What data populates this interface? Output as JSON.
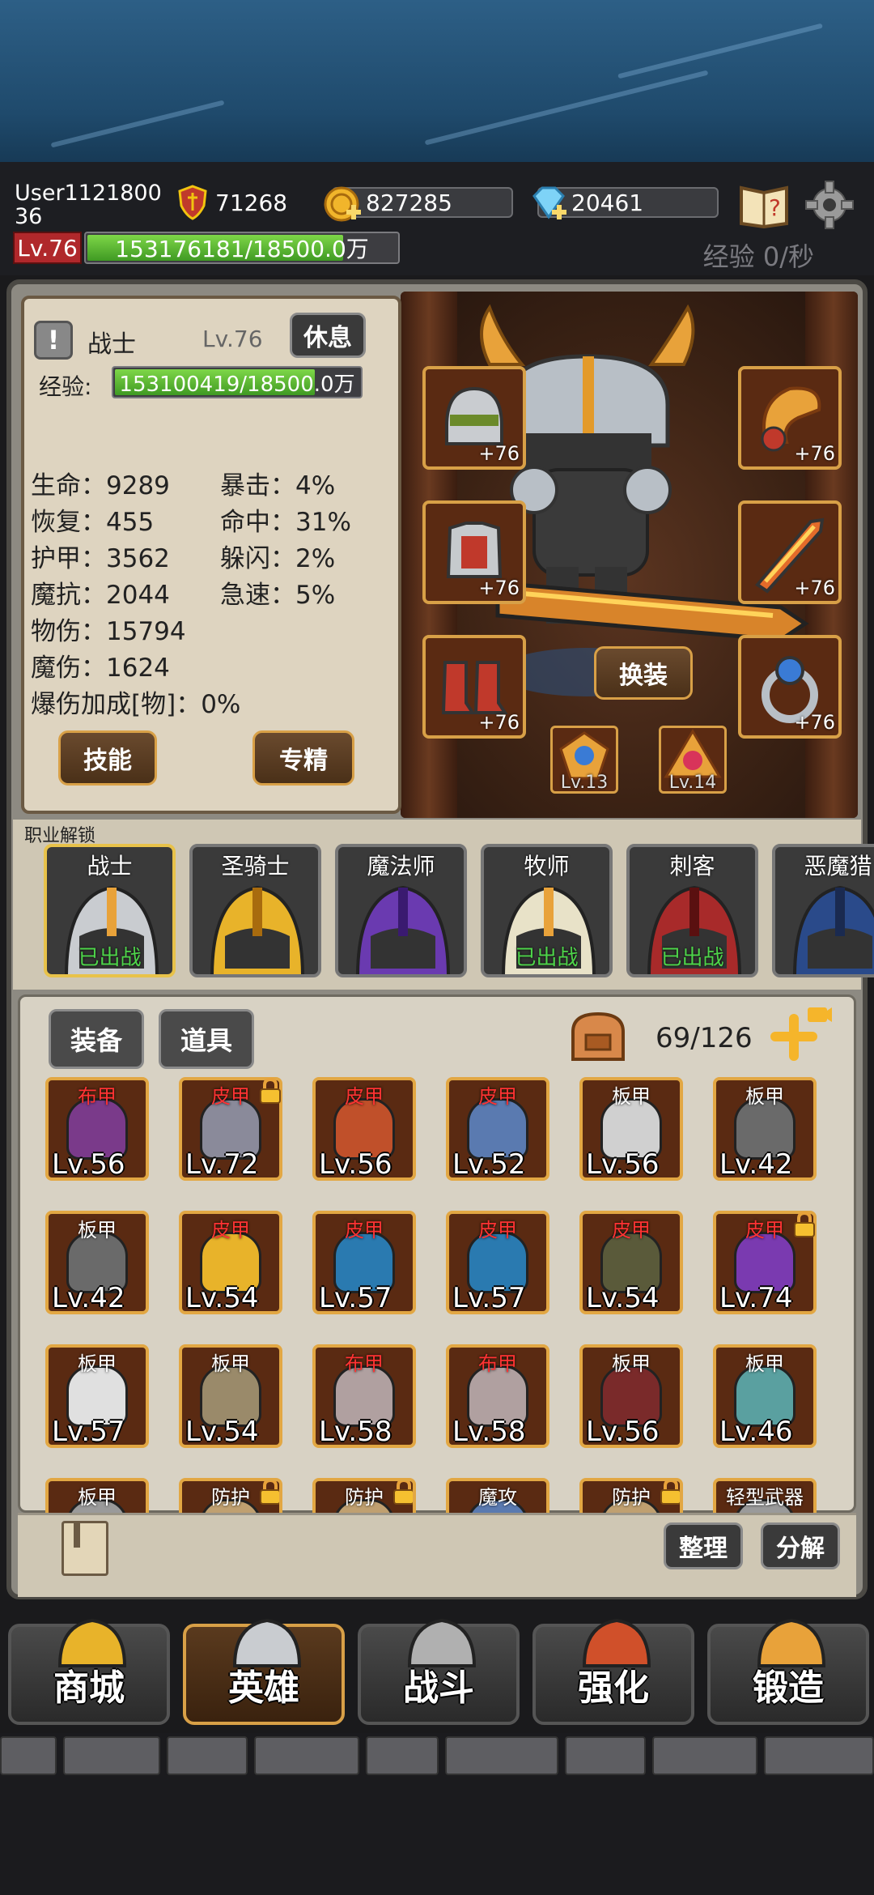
{
  "player": {
    "name": "User1121800\n36",
    "level": "Lv.76",
    "xp": "153176181/18500.0万",
    "xp_fill": 0.83,
    "exp_rate": "经验 0/秒"
  },
  "currencies": {
    "power": "71268",
    "gold": "827285",
    "gems": "20461"
  },
  "hero_panel": {
    "class": "战士",
    "level": "Lv.76",
    "rest": "休息",
    "xp_label": "经验:",
    "xp": "153100419/18500.0万",
    "xp_fill": 0.82,
    "stats_left": [
      "生命：9289",
      "恢复：455",
      "护甲：3562",
      "魔抗：2044",
      "物伤：15794",
      "魔伤：1624",
      "爆伤加成[物]：0%"
    ],
    "stats_right": [
      "暴击：4%",
      "命中：31%",
      "躲闪：2%",
      "急速：5%"
    ],
    "skill_btn": "技能",
    "mastery_btn": "专精"
  },
  "equipment": {
    "swap": "换装",
    "plus": "+76",
    "gem1": "Lv.13",
    "gem2": "Lv.14"
  },
  "classes": {
    "label": "职业解锁",
    "list": [
      {
        "name": "战士",
        "status": "已出战"
      },
      {
        "name": "圣骑士",
        "status": ""
      },
      {
        "name": "魔法师",
        "status": ""
      },
      {
        "name": "牧师",
        "status": "已出战"
      },
      {
        "name": "刺客",
        "status": "已出战"
      },
      {
        "name": "恶魔猎",
        "status": ""
      }
    ]
  },
  "inventory": {
    "tab_equip": "装备",
    "tab_items": "道具",
    "capacity": "69/126",
    "sort": "整理",
    "decompose": "分解",
    "items": [
      {
        "type": "布甲",
        "lv": "Lv.56",
        "red": true,
        "lock": false
      },
      {
        "type": "皮甲",
        "lv": "Lv.72",
        "red": true,
        "lock": true
      },
      {
        "type": "皮甲",
        "lv": "Lv.56",
        "red": true,
        "lock": false
      },
      {
        "type": "皮甲",
        "lv": "Lv.52",
        "red": true,
        "lock": false
      },
      {
        "type": "板甲",
        "lv": "Lv.56",
        "red": false,
        "lock": false
      },
      {
        "type": "板甲",
        "lv": "Lv.42",
        "red": false,
        "lock": false
      },
      {
        "type": "板甲",
        "lv": "Lv.42",
        "red": false,
        "lock": false
      },
      {
        "type": "皮甲",
        "lv": "Lv.54",
        "red": true,
        "lock": false
      },
      {
        "type": "皮甲",
        "lv": "Lv.57",
        "red": true,
        "lock": false
      },
      {
        "type": "皮甲",
        "lv": "Lv.57",
        "red": true,
        "lock": false
      },
      {
        "type": "皮甲",
        "lv": "Lv.54",
        "red": true,
        "lock": false
      },
      {
        "type": "皮甲",
        "lv": "Lv.74",
        "red": true,
        "lock": true
      },
      {
        "type": "板甲",
        "lv": "Lv.57",
        "red": false,
        "lock": false
      },
      {
        "type": "板甲",
        "lv": "Lv.54",
        "red": false,
        "lock": false
      },
      {
        "type": "布甲",
        "lv": "Lv.58",
        "red": true,
        "lock": false
      },
      {
        "type": "布甲",
        "lv": "Lv.58",
        "red": true,
        "lock": false
      },
      {
        "type": "板甲",
        "lv": "Lv.56",
        "red": false,
        "lock": false
      },
      {
        "type": "板甲",
        "lv": "Lv.46",
        "red": false,
        "lock": false
      },
      {
        "type": "板甲",
        "lv": "",
        "red": false,
        "lock": false
      },
      {
        "type": "防护",
        "lv": "",
        "red": false,
        "lock": true
      },
      {
        "type": "防护",
        "lv": "",
        "red": false,
        "lock": true
      },
      {
        "type": "魔攻",
        "lv": "",
        "red": false,
        "lock": false
      },
      {
        "type": "防护",
        "lv": "",
        "red": false,
        "lock": true
      },
      {
        "type": "轻型武器",
        "lv": "",
        "red": false,
        "lock": false
      }
    ]
  },
  "nav": [
    "商城",
    "英雄",
    "战斗",
    "强化",
    "锻造"
  ]
}
